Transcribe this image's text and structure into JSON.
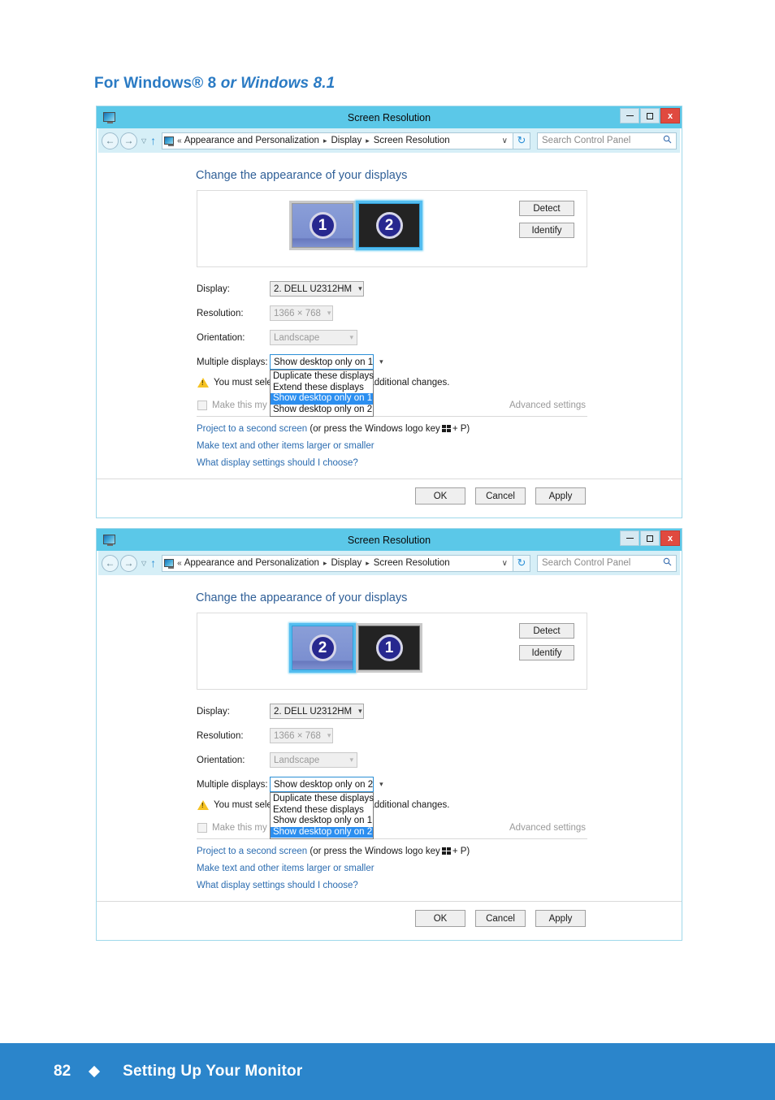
{
  "heading": {
    "prefix": "For Windows® 8 ",
    "italic": "or Windows 8.1"
  },
  "window": {
    "title": "Screen Resolution",
    "titlebar_buttons": {
      "minimize": "minimize-icon",
      "maximize": "maximize-icon",
      "close": "x"
    },
    "nav": {
      "back": "←",
      "forward": "→",
      "history_caret": "▽",
      "up": "↑",
      "chevrons": "«",
      "crumb1": "Appearance and Personalization",
      "crumb2": "Display",
      "crumb3": "Screen Resolution",
      "separator": "▸",
      "address_dropdown": "∨",
      "refresh": "↻",
      "search_placeholder": "Search Control Panel",
      "search_value": "",
      "search_icon": "⌕"
    },
    "section_title": "Change the appearance of your displays",
    "buttons": {
      "detect": "Detect",
      "identify": "Identify"
    },
    "fields": {
      "display_label": "Display:",
      "display_value": "2. DELL U2312HM",
      "resolution_label": "Resolution:",
      "resolution_value": "1366 × 768",
      "orientation_label": "Orientation:",
      "orientation_value": "Landscape",
      "multiple_label": "Multiple displays:"
    },
    "warning_text": "You must select Apply before making additional changes.",
    "checkbox_label": "Make this my main display",
    "advanced_settings": "Advanced settings",
    "links": {
      "project_link": "Project to a second screen",
      "project_rest_a": "(or press the Windows logo key",
      "project_rest_b": "+ P)",
      "make_text": "Make text and other items larger or smaller",
      "what_display": "What display settings should I choose?"
    },
    "footer_buttons": {
      "ok": "OK",
      "cancel": "Cancel",
      "apply": "Apply"
    },
    "dropdown_options": [
      "Duplicate these displays",
      "Extend these displays",
      "Show desktop only on 1",
      "Show desktop only on 2"
    ]
  },
  "window1": {
    "monitors": [
      {
        "number": "1",
        "style": "light",
        "selected": false
      },
      {
        "number": "2",
        "style": "dark",
        "selected": true
      }
    ],
    "multiple_value": "Show desktop only on 1",
    "highlighted_index": 2
  },
  "window2": {
    "monitors": [
      {
        "number": "2",
        "style": "light",
        "selected": true
      },
      {
        "number": "1",
        "style": "dark",
        "selected": false
      }
    ],
    "multiple_value": "Show desktop only on 2",
    "highlighted_index": 3
  },
  "page_footer": {
    "page_number": "82",
    "title": "Setting Up Your Monitor"
  },
  "colors": {
    "brand_blue": "#2b85cb",
    "titlebar": "#5bc8e8",
    "navbar": "#d6eff7",
    "link": "#2b6cb0",
    "highlight": "#2c8ff0",
    "close_red": "#e04a3f"
  }
}
